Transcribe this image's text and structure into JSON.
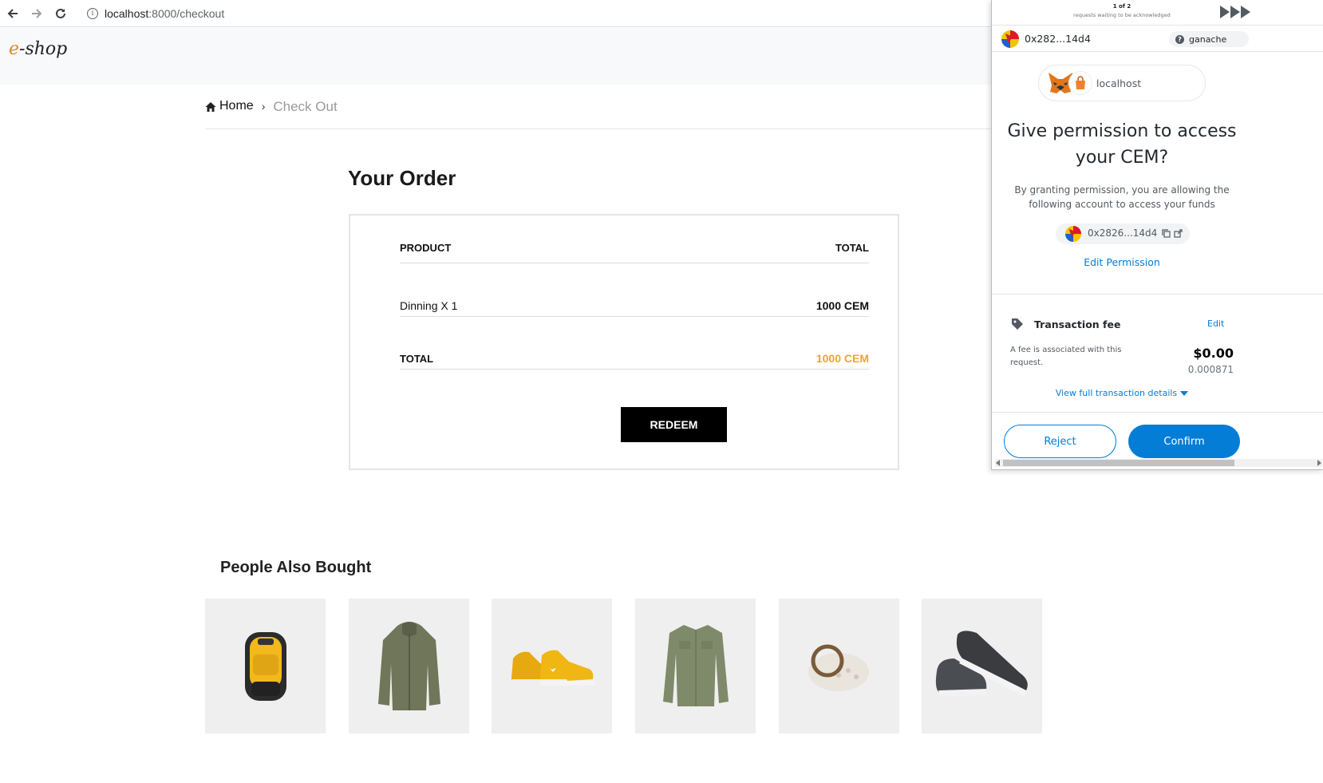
{
  "browser": {
    "url_host": "localhost",
    "url_path": ":8000/checkout"
  },
  "site": {
    "logo_e": "e",
    "logo_rest": "-shop"
  },
  "breadcrumb": {
    "home": "Home",
    "current": "Check Out"
  },
  "order": {
    "title": "Your Order",
    "col_product": "PRODUCT",
    "col_total": "TOTAL",
    "item_name": "Dinning X 1",
    "item_amount": "1000 CEM",
    "total_label": "TOTAL",
    "total_amount": "1000 CEM",
    "redeem_label": "REDEEM"
  },
  "also_bought": {
    "title": "People Also Bought",
    "items": [
      "backpack",
      "jacket",
      "sneakers",
      "shirt",
      "handbag",
      "slip-on shoes"
    ]
  },
  "metamask": {
    "request_count": "1 of 2",
    "request_wait": "requests waiting to be acknowledged",
    "account_addr": "0x282...14d4",
    "network": "ganache",
    "origin": "localhost",
    "title": "Give permission to access your CEM?",
    "description": "By granting permission, you are allowing the following account to access your funds",
    "chip_addr": "0x2826...14d4",
    "edit_permission": "Edit Permission",
    "fee_title": "Transaction fee",
    "fee_edit": "Edit",
    "fee_desc": "A fee is associated with this request.",
    "fee_usd": "$0.00",
    "fee_eth": "0.000871",
    "view_details": "View full transaction details",
    "reject": "Reject",
    "confirm": "Confirm"
  },
  "colors": {
    "accent_orange": "#e8a633",
    "mm_blue": "#037dd6"
  }
}
